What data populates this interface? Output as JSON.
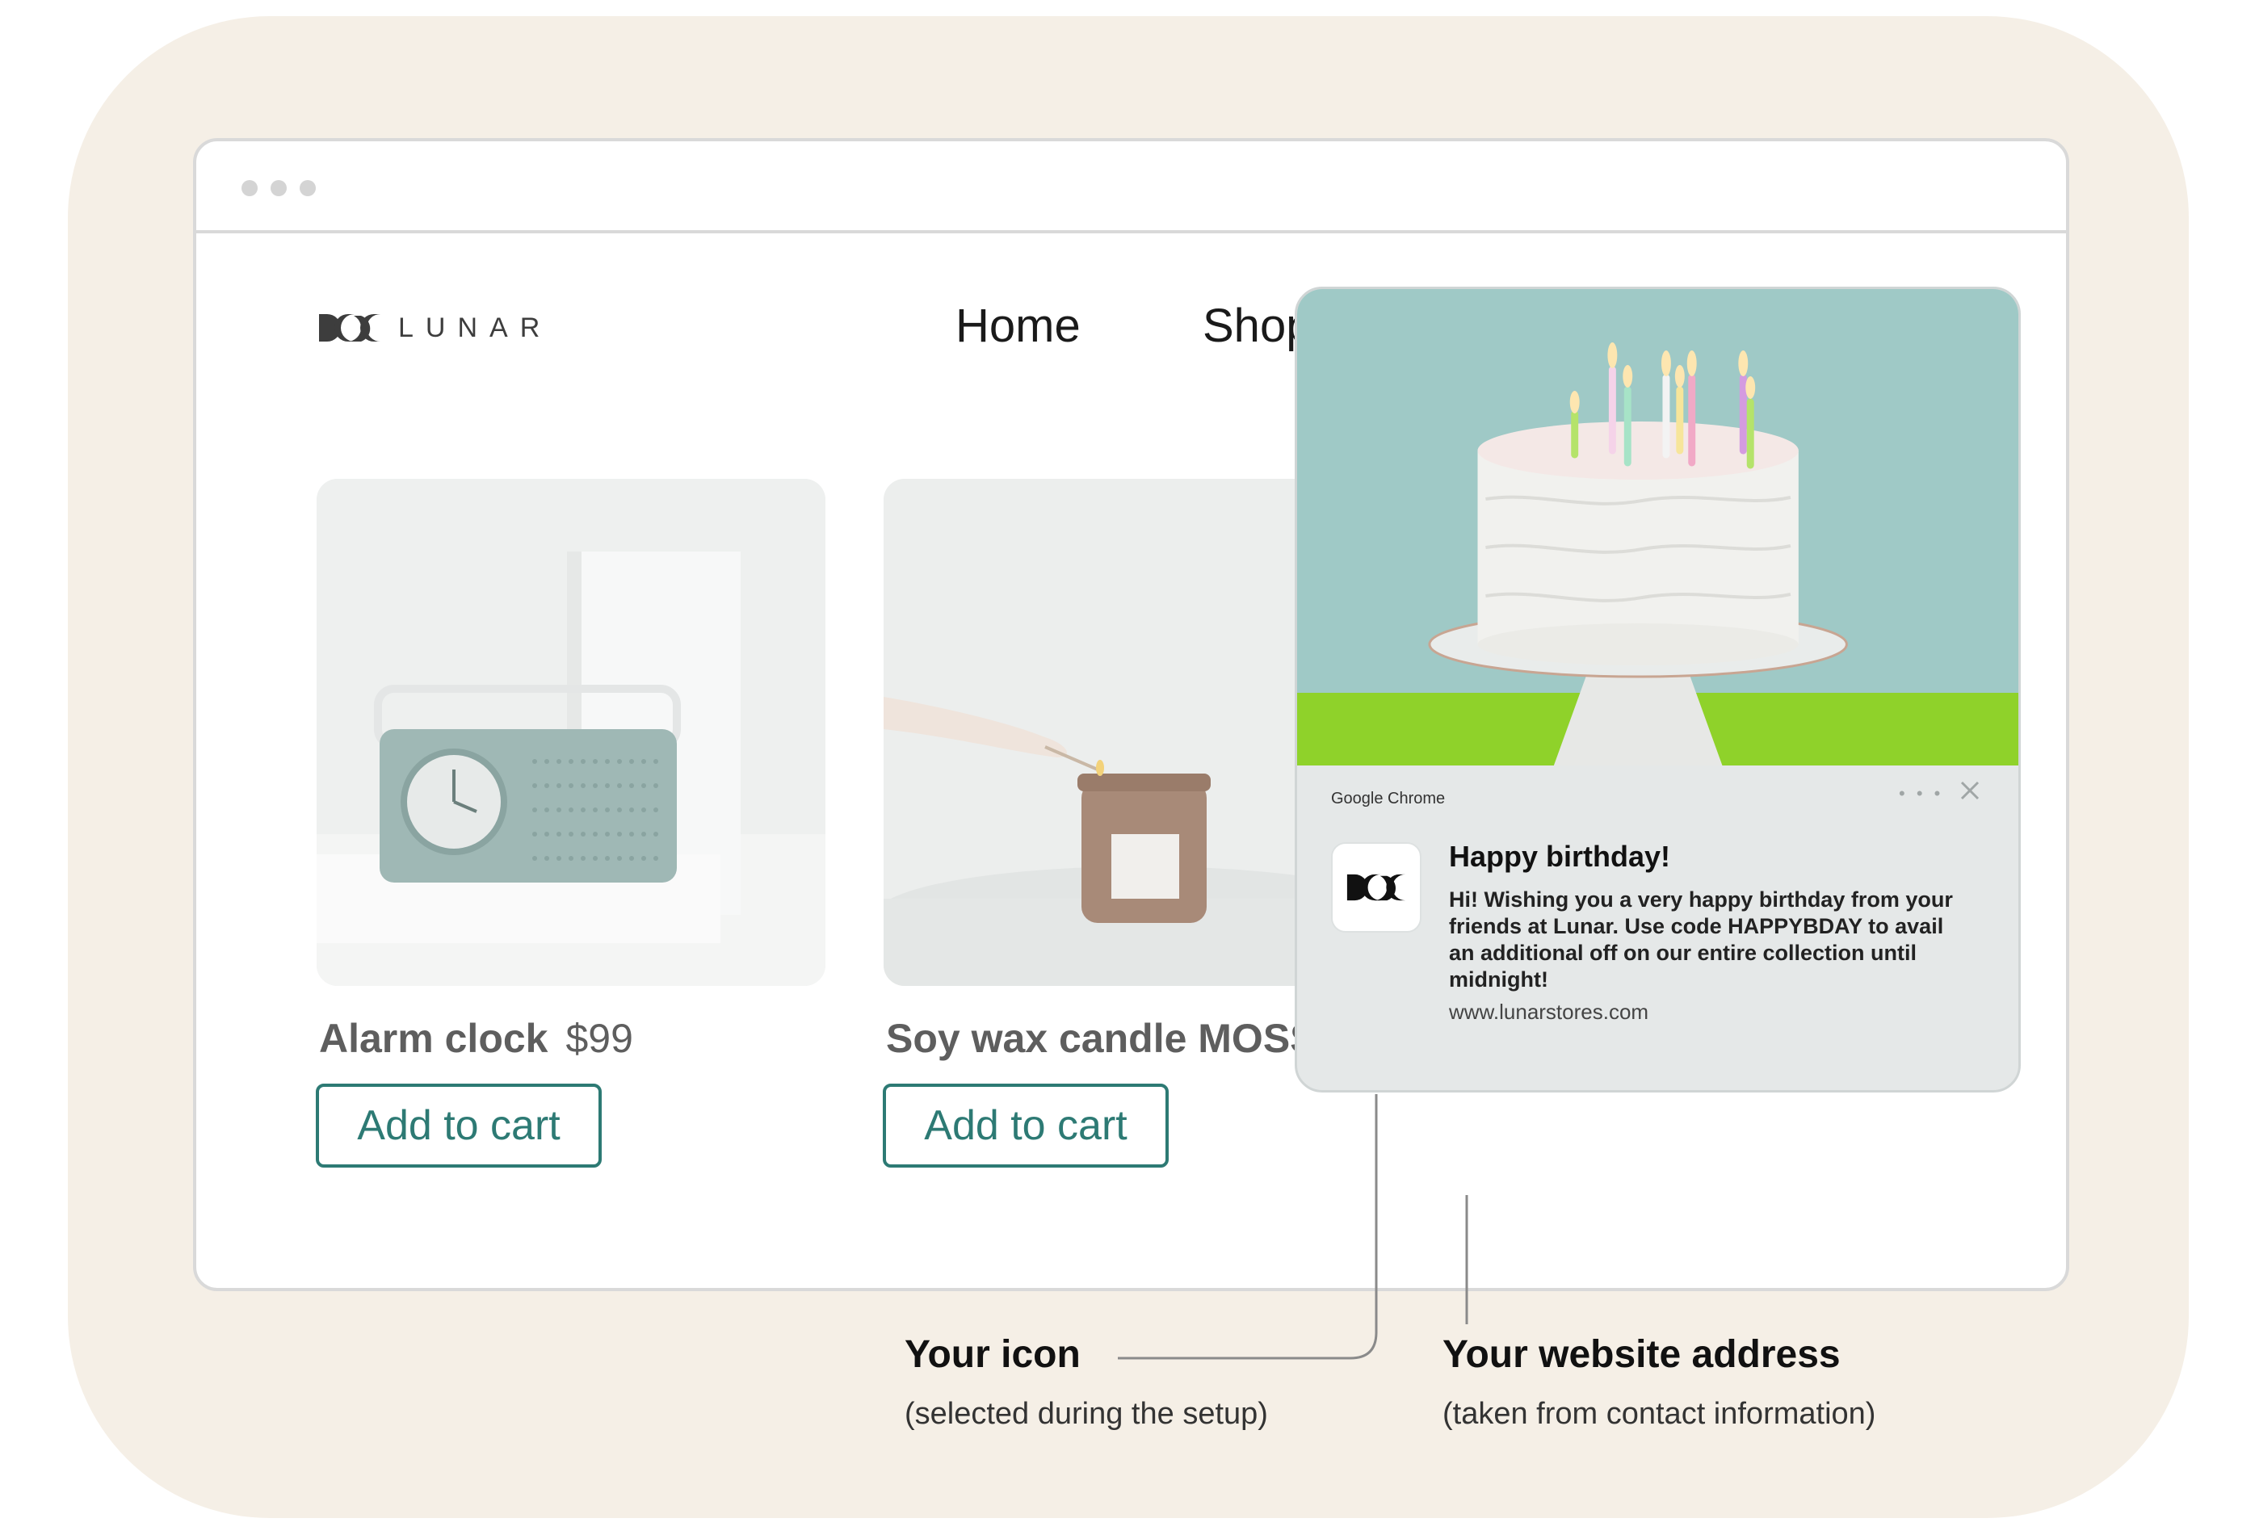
{
  "brand": {
    "name": "LUNAR",
    "accent": "#2d7a74",
    "background": "#f5efe6"
  },
  "nav": {
    "home": "Home",
    "shop": "Shop"
  },
  "header_icons": [
    "search-icon",
    "cart-icon"
  ],
  "products": [
    {
      "title": "Alarm clock",
      "price": "$99",
      "button": "Add to cart",
      "image": "alarm-clock"
    },
    {
      "title": "Soy wax candle MOSS",
      "button": "Add to cart",
      "image": "candle"
    }
  ],
  "notification": {
    "source": "Google Chrome",
    "title": "Happy birthday!",
    "body": "Hi! Wishing you a very happy birthday from your friends at Lunar. Use code HAPPYBDAY to avail an additional off on our entire collection until midnight!",
    "url": "www.lunarstores.com",
    "more": "• • •",
    "image": "birthday-cake"
  },
  "annotations": {
    "icon_title": "Your icon",
    "icon_sub": "(selected during the setup)",
    "address_title": "Your website address",
    "address_sub": "(taken from contact information)"
  }
}
